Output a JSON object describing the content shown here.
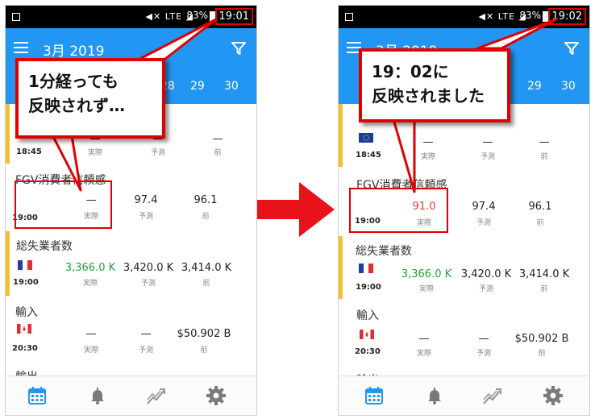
{
  "colors": {
    "appbar": "#2196f3",
    "highlight_bar": "#f3c12a",
    "callout_border": "#e00000",
    "actual_up": "#22a033",
    "actual_down": "#e53935"
  },
  "left": {
    "status": {
      "battery": "83%",
      "clock": "19:01",
      "net": "LTE"
    },
    "month": "3月 2019",
    "dates": [
      "28",
      "29",
      "30"
    ],
    "events": [
      {
        "title": "",
        "time": "18:45",
        "actual": "—",
        "forecast": "—",
        "previous": "—",
        "flag": "eu"
      },
      {
        "title": "FGV消費者信頼感",
        "time": "19:00",
        "actual": "—",
        "forecast": "97.4",
        "previous": "96.1",
        "flag": ""
      },
      {
        "title": "総失業者数",
        "time": "19:00",
        "actual": "3,366.0 K",
        "forecast": "3,420.0 K",
        "previous": "3,414.0 K",
        "flag": "fr"
      },
      {
        "title": "輸入",
        "time": "20:30",
        "actual": "—",
        "forecast": "—",
        "previous": "$50.902 B",
        "flag": "ca"
      },
      {
        "title": "輸出",
        "time": "",
        "actual": "",
        "forecast": "",
        "previous": "",
        "flag": ""
      }
    ],
    "callout": {
      "line1": "1分経っても",
      "line2": "反映されず…"
    }
  },
  "right": {
    "status": {
      "battery": "83%",
      "clock": "19:02",
      "net": "LTE"
    },
    "month": "3月 2019",
    "dates": [
      "29",
      "30"
    ],
    "events": [
      {
        "title": "",
        "time": "18:45",
        "actual": "—",
        "forecast": "—",
        "previous": "—",
        "flag": "eu"
      },
      {
        "title": "FGV消費者信頼感",
        "time": "19:00",
        "actual": "91.0",
        "forecast": "97.4",
        "previous": "96.1",
        "flag": ""
      },
      {
        "title": "総失業者数",
        "time": "19:00",
        "actual": "3,366.0 K",
        "forecast": "3,420.0 K",
        "previous": "3,414.0 K",
        "flag": "fr"
      },
      {
        "title": "輸入",
        "time": "20:30",
        "actual": "—",
        "forecast": "—",
        "previous": "$50.902 B",
        "flag": "ca"
      },
      {
        "title": "輸出",
        "time": "",
        "actual": "",
        "forecast": "",
        "previous": "",
        "flag": ""
      }
    ],
    "callout": {
      "line1": "19：02に",
      "line2": "反映されました"
    }
  },
  "labels": {
    "actual": "実際",
    "forecast": "予測",
    "previous": "前"
  },
  "icons": {
    "menu": "hamburger-icon",
    "filter": "filter-icon",
    "calendar": "calendar-icon",
    "alerts": "bell-icon",
    "trend": "trend-icon",
    "settings": "gear-icon",
    "arrow": "right-arrow"
  }
}
